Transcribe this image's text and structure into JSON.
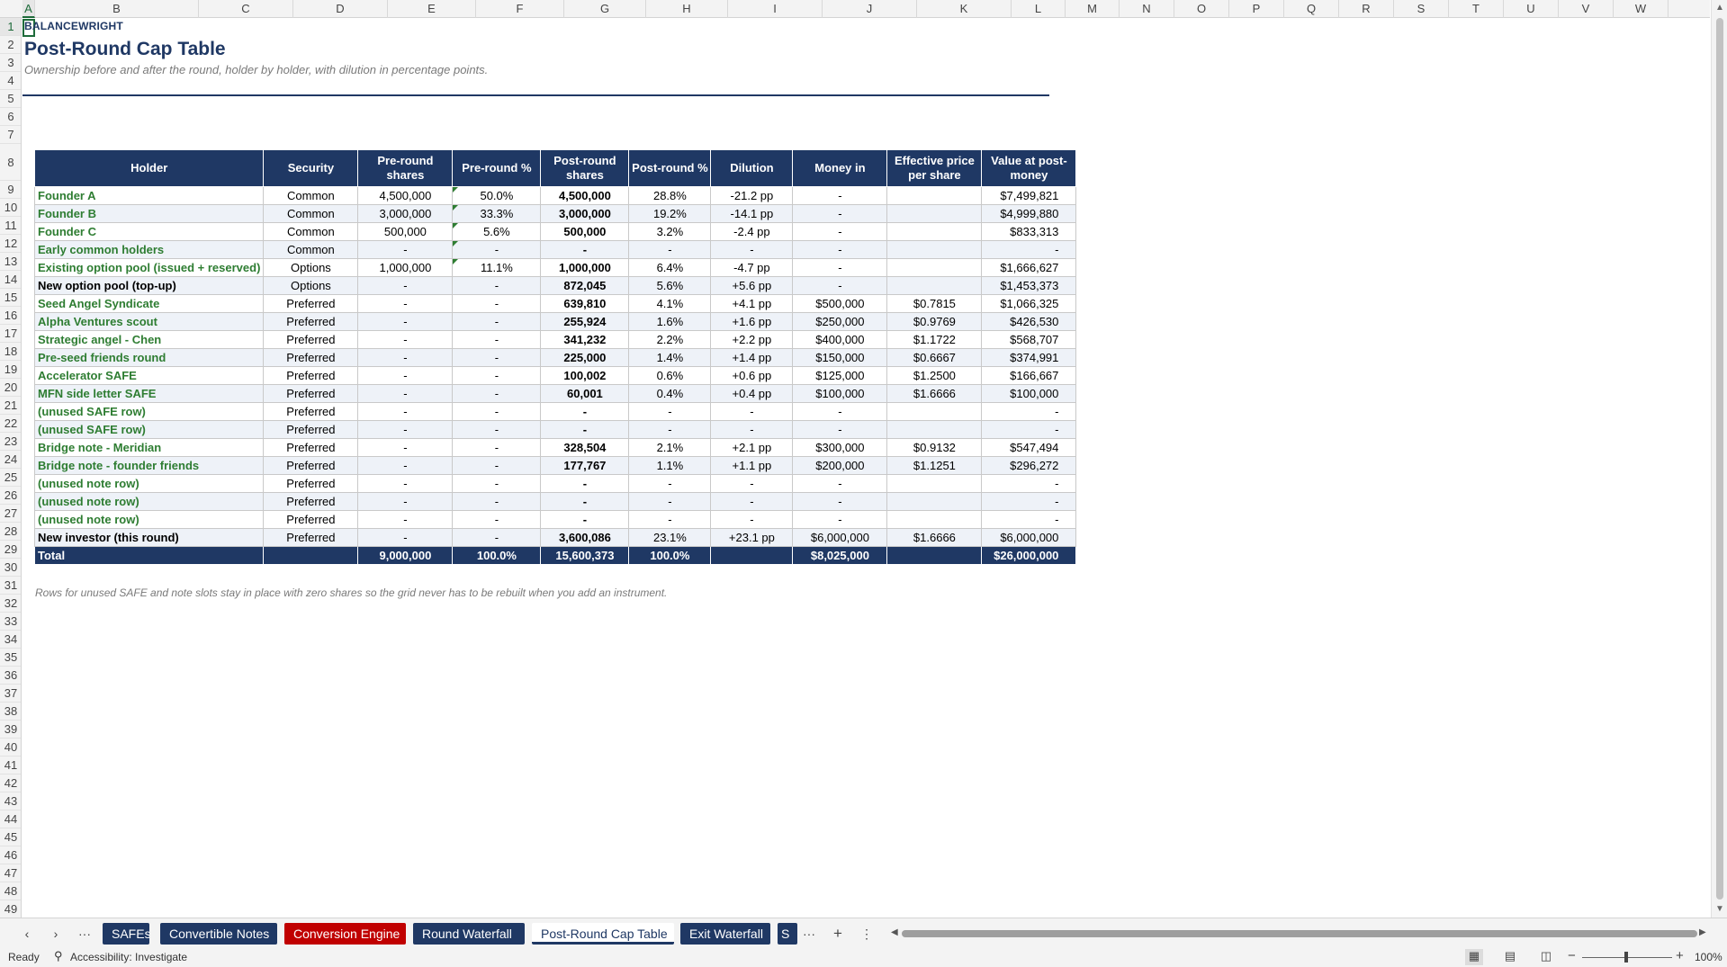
{
  "sheet": {
    "columns": [
      "A",
      "B",
      "C",
      "D",
      "E",
      "F",
      "G",
      "H",
      "I",
      "J",
      "K",
      "L",
      "M",
      "N",
      "O",
      "P",
      "Q",
      "R",
      "S",
      "T",
      "U",
      "V",
      "W"
    ],
    "selected_column": "A",
    "rows": [
      "1",
      "2",
      "3",
      "4",
      "5",
      "6",
      "7",
      "8",
      "9",
      "10",
      "11",
      "12",
      "13",
      "14",
      "15",
      "16",
      "17",
      "18",
      "19",
      "20",
      "21",
      "22",
      "23",
      "24",
      "25",
      "26",
      "27",
      "28",
      "29",
      "30",
      "31",
      "32",
      "33",
      "34",
      "35",
      "36",
      "37",
      "38",
      "39",
      "40",
      "41",
      "42",
      "43",
      "44",
      "45",
      "46",
      "47",
      "48",
      "49"
    ],
    "selected_row": "1"
  },
  "header": {
    "brand": "BALANCEWRIGHT",
    "title": "Post-Round Cap Table",
    "subtitle": "Ownership before and after the round, holder by holder, with dilution in percentage points."
  },
  "table": {
    "headers": [
      "Holder",
      "Security",
      "Pre-round shares",
      "Pre-round %",
      "Post-round shares",
      "Post-round %",
      "Dilution",
      "Money in",
      "Effective price per share",
      "Value at post-money"
    ],
    "rows": [
      [
        "Founder A",
        "Common",
        "4,500,000",
        "50.0%",
        "4,500,000",
        "28.8%",
        "-21.2 pp",
        "-",
        "",
        "$7,499,821"
      ],
      [
        "Founder B",
        "Common",
        "3,000,000",
        "33.3%",
        "3,000,000",
        "19.2%",
        "-14.1 pp",
        "-",
        "",
        "$4,999,880"
      ],
      [
        "Founder C",
        "Common",
        "500,000",
        "5.6%",
        "500,000",
        "3.2%",
        "-2.4 pp",
        "-",
        "",
        "$833,313"
      ],
      [
        "Early common holders",
        "Common",
        "-",
        "-",
        "-",
        "-",
        "-",
        "-",
        "",
        "-"
      ],
      [
        "Existing option pool (issued + reserved)",
        "Options",
        "1,000,000",
        "11.1%",
        "1,000,000",
        "6.4%",
        "-4.7 pp",
        "-",
        "",
        "$1,666,627"
      ],
      [
        "New option pool (top-up)",
        "Options",
        "-",
        "-",
        "872,045",
        "5.6%",
        "+5.6 pp",
        "-",
        "",
        "$1,453,373"
      ],
      [
        "Seed Angel Syndicate",
        "Preferred",
        "-",
        "-",
        "639,810",
        "4.1%",
        "+4.1 pp",
        "$500,000",
        "$0.7815",
        "$1,066,325"
      ],
      [
        "Alpha Ventures scout",
        "Preferred",
        "-",
        "-",
        "255,924",
        "1.6%",
        "+1.6 pp",
        "$250,000",
        "$0.9769",
        "$426,530"
      ],
      [
        "Strategic angel - Chen",
        "Preferred",
        "-",
        "-",
        "341,232",
        "2.2%",
        "+2.2 pp",
        "$400,000",
        "$1.1722",
        "$568,707"
      ],
      [
        "Pre-seed friends round",
        "Preferred",
        "-",
        "-",
        "225,000",
        "1.4%",
        "+1.4 pp",
        "$150,000",
        "$0.6667",
        "$374,991"
      ],
      [
        "Accelerator SAFE",
        "Preferred",
        "-",
        "-",
        "100,002",
        "0.6%",
        "+0.6 pp",
        "$125,000",
        "$1.2500",
        "$166,667"
      ],
      [
        "MFN side letter SAFE",
        "Preferred",
        "-",
        "-",
        "60,001",
        "0.4%",
        "+0.4 pp",
        "$100,000",
        "$1.6666",
        "$100,000"
      ],
      [
        "(unused SAFE row)",
        "Preferred",
        "-",
        "-",
        "-",
        "-",
        "-",
        "-",
        "",
        "-"
      ],
      [
        "(unused SAFE row)",
        "Preferred",
        "-",
        "-",
        "-",
        "-",
        "-",
        "-",
        "",
        "-"
      ],
      [
        "Bridge note - Meridian",
        "Preferred",
        "-",
        "-",
        "328,504",
        "2.1%",
        "+2.1 pp",
        "$300,000",
        "$0.9132",
        "$547,494"
      ],
      [
        "Bridge note - founder friends",
        "Preferred",
        "-",
        "-",
        "177,767",
        "1.1%",
        "+1.1 pp",
        "$200,000",
        "$1.1251",
        "$296,272"
      ],
      [
        "(unused note row)",
        "Preferred",
        "-",
        "-",
        "-",
        "-",
        "-",
        "-",
        "",
        "-"
      ],
      [
        "(unused note row)",
        "Preferred",
        "-",
        "-",
        "-",
        "-",
        "-",
        "-",
        "",
        "-"
      ],
      [
        "(unused note row)",
        "Preferred",
        "-",
        "-",
        "-",
        "-",
        "-",
        "-",
        "",
        "-"
      ],
      [
        "New investor (this round)",
        "Preferred",
        "-",
        "-",
        "3,600,086",
        "23.1%",
        "+23.1 pp",
        "$6,000,000",
        "$1.6666",
        "$6,000,000"
      ]
    ],
    "total": [
      "Total",
      "",
      "9,000,000",
      "100.0%",
      "15,600,373",
      "100.0%",
      "",
      "$8,025,000",
      "",
      "$26,000,000"
    ]
  },
  "note": "Rows for unused SAFE and note slots stay in place with zero shares so the grid never has to be rebuilt when you add an instrument.",
  "tabs": [
    {
      "label": "SAFEs",
      "color": "#1f3864"
    },
    {
      "label": "Convertible Notes",
      "color": "#1f3864"
    },
    {
      "label": "Conversion Engine",
      "color": "#c00000"
    },
    {
      "label": "Round Waterfall",
      "color": "#1f3864"
    },
    {
      "label": "Post-Round Cap Table",
      "active": true
    },
    {
      "label": "Exit Waterfall",
      "color": "#1f3864"
    },
    {
      "label": "S",
      "color": "#1f3864"
    }
  ],
  "tabbar": {
    "more": "···",
    "add": "+",
    "options": "⋮"
  },
  "status": {
    "ready": "Ready",
    "accessibility": "Accessibility: Investigate",
    "zoom": "100%"
  },
  "colors": {
    "accent": "#1f3864",
    "input_text": "#2e7d32",
    "alert_tab": "#c00000",
    "selection": "#1e6b3a"
  }
}
